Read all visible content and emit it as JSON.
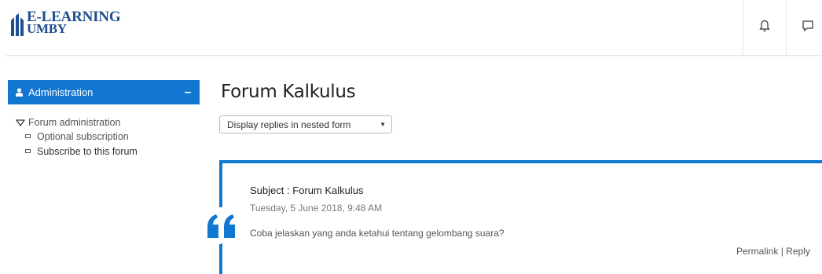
{
  "header": {
    "logo_line1": "E-LEARNING",
    "logo_line2": "UMBY",
    "brand_color": "#1d4e8f"
  },
  "sidebar": {
    "block_title": "Administration",
    "collapse_symbol": "–",
    "accent": "#1177d1",
    "tree_root": "Forum administration",
    "items": [
      {
        "label": "Optional subscription"
      },
      {
        "label": "Subscribe to this forum"
      }
    ]
  },
  "main": {
    "title": "Forum Kalkulus",
    "display_mode": "Display replies in nested form",
    "post": {
      "subject": "Subject : Forum Kalkulus",
      "date": "Tuesday, 5 June 2018, 9:48 AM",
      "message": "Coba jelaskan yang anda ketahui tentang gelombang suara?",
      "permalink_label": "Permalink",
      "separator": " | ",
      "reply_label": "Reply"
    }
  },
  "icons": {
    "bell": "bell-icon",
    "message": "message-icon",
    "user": "user-icon",
    "quote": "quote-icon"
  }
}
